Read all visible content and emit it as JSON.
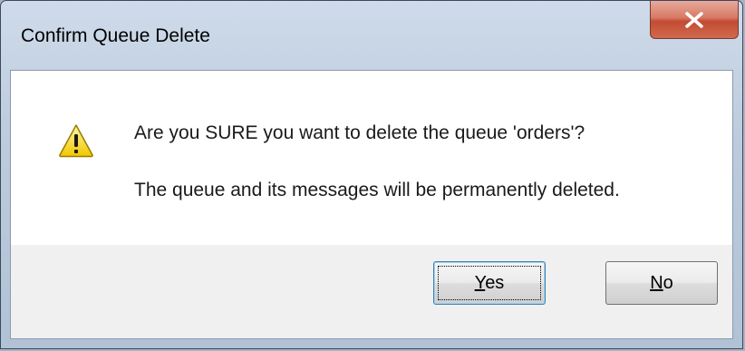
{
  "window": {
    "title": "Confirm Queue Delete",
    "close_icon": "close-x-icon"
  },
  "message": {
    "icon": "warning-icon",
    "line1": "Are you SURE you want to delete the queue 'orders'?",
    "line2": "The queue and its messages will be permanently deleted."
  },
  "buttons": {
    "yes": {
      "accel": "Y",
      "rest": "es",
      "default": true
    },
    "no": {
      "accel": "N",
      "rest": "o",
      "default": false
    }
  },
  "colors": {
    "close_button": "#c24b33",
    "content_bg": "#ffffff",
    "button_bar_bg": "#f0f0f0",
    "warning_yellow": "#f5d000"
  }
}
